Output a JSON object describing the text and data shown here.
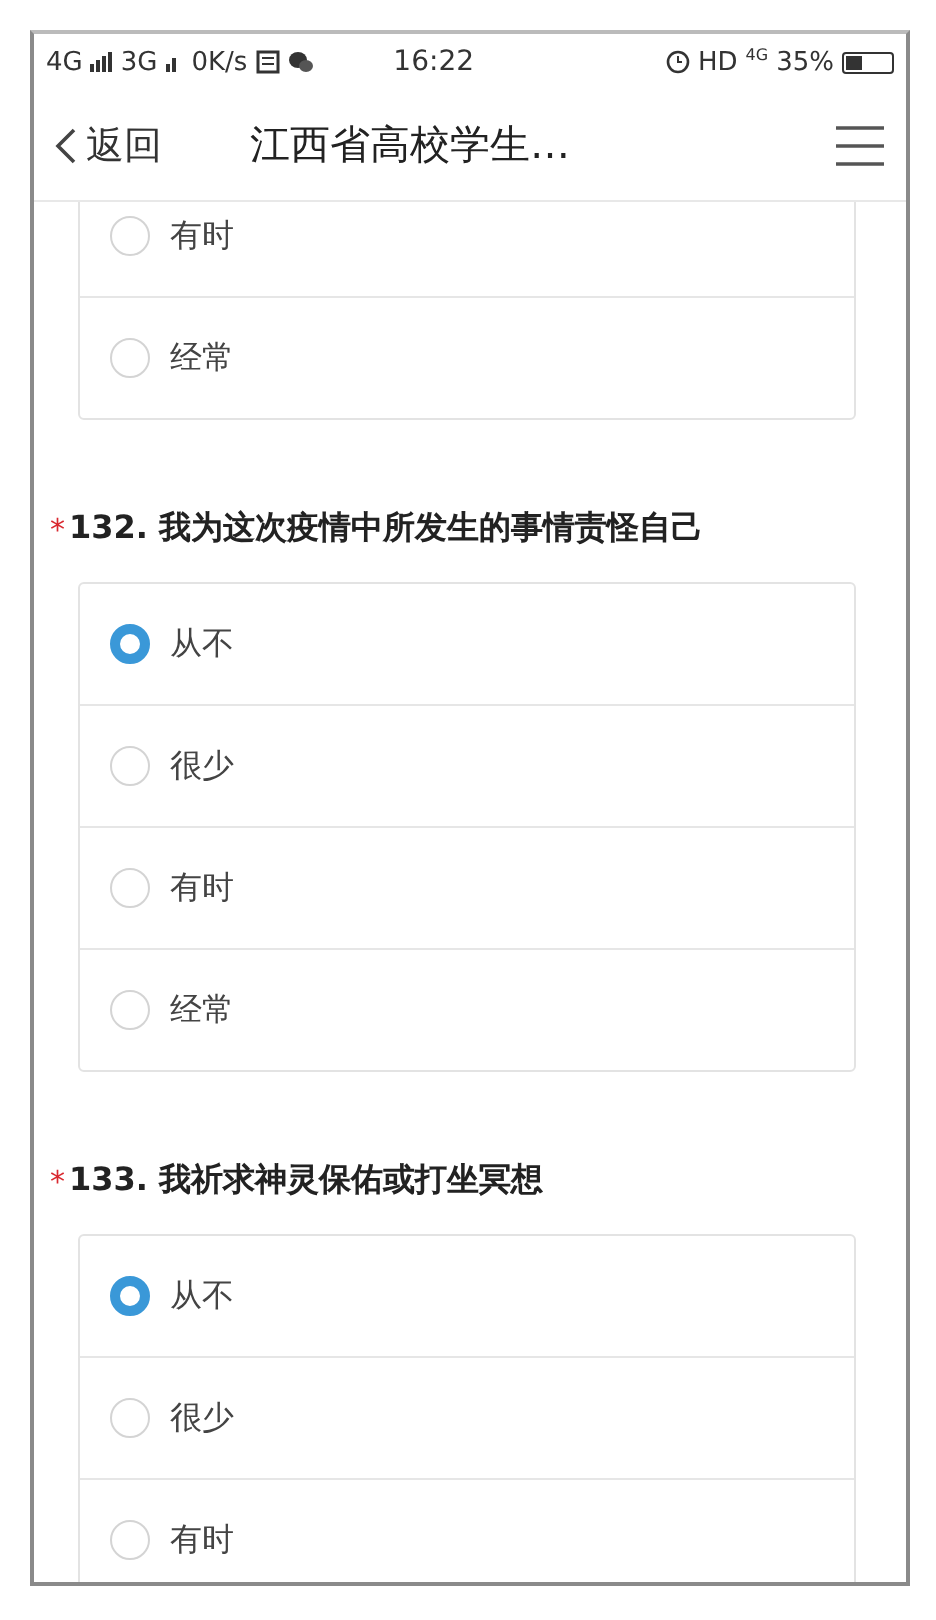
{
  "status_bar": {
    "network_1": "4G",
    "network_2": "3G",
    "speed": "0K/s",
    "time": "16:22",
    "hd": "HD",
    "network_3": "4G",
    "battery": "35%"
  },
  "nav_bar": {
    "back": "返回",
    "title": "江西省高校学生…"
  },
  "questions": [
    {
      "options": [
        {
          "label": "有时",
          "selected": false
        },
        {
          "label": "经常",
          "selected": false
        }
      ]
    },
    {
      "mark": "*",
      "title": "132. 我为这次疫情中所发生的事情责怪自己",
      "options": [
        {
          "label": "从不",
          "selected": true
        },
        {
          "label": "很少",
          "selected": false
        },
        {
          "label": "有时",
          "selected": false
        },
        {
          "label": "经常",
          "selected": false
        }
      ]
    },
    {
      "mark": "*",
      "title": "133. 我祈求神灵保佑或打坐冥想",
      "options": [
        {
          "label": "从不",
          "selected": true
        },
        {
          "label": "很少",
          "selected": false
        },
        {
          "label": "有时",
          "selected": false
        }
      ]
    }
  ]
}
